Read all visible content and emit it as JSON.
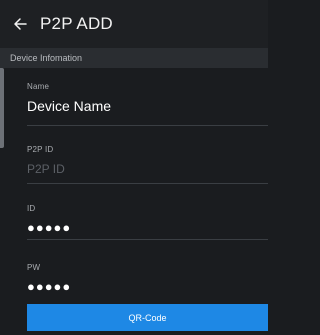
{
  "header": {
    "title": "P2P ADD",
    "back_icon": "arrow-left-icon"
  },
  "section": {
    "title": "Device Infomation"
  },
  "fields": {
    "name": {
      "label": "Name",
      "value": "Device Name"
    },
    "p2p_id": {
      "label": "P2P ID",
      "placeholder": "P2P ID"
    },
    "id": {
      "label": "ID",
      "value": "●●●●●"
    },
    "pw": {
      "label": "PW",
      "value": "●●●●●"
    }
  },
  "button": {
    "label": "QR-Code"
  },
  "colors": {
    "accent": "#1e88e5",
    "background": "#1a1c1f",
    "section": "#2a2d31"
  }
}
